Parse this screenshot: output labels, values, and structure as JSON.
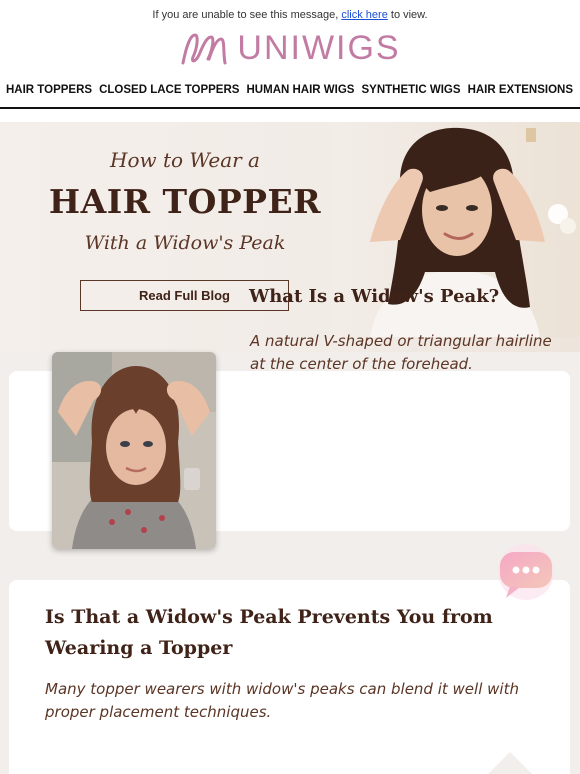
{
  "topbar": {
    "prefix": "If you are unable to see this message, ",
    "link": "click here",
    "suffix": " to view."
  },
  "brand": {
    "name": "UNIWIGS",
    "color": "#c27ba2"
  },
  "nav": {
    "items": [
      {
        "label": "HAIR TOPPERS"
      },
      {
        "label": "CLOSED LACE TOPPERS"
      },
      {
        "label": "HUMAN HAIR WIGS"
      },
      {
        "label": "SYNTHETIC WIGS"
      },
      {
        "label": "HAIR EXTENSIONS"
      }
    ]
  },
  "hero": {
    "line1": "How to Wear a",
    "line2": "HAIR TOPPER",
    "line3": "With a Widow's Peak",
    "button": "Read Full Blog"
  },
  "card1": {
    "title": "What Is a Widow's Peak?",
    "text": "A natural V-shaped or triangular hairline at the center of the forehead."
  },
  "card2": {
    "title": "Is That a Widow's Peak Prevents You from Wearing a Topper",
    "text": "Many topper wearers with widow's peaks can blend it well with proper placement techniques."
  },
  "colors": {
    "accent_brown": "#3f2218",
    "text_brown": "#5b3525",
    "background": "#f2eeeb",
    "link_blue": "#1a4fd6"
  },
  "icons": [
    "logo-mark-icon",
    "chat-bubble-icon"
  ]
}
